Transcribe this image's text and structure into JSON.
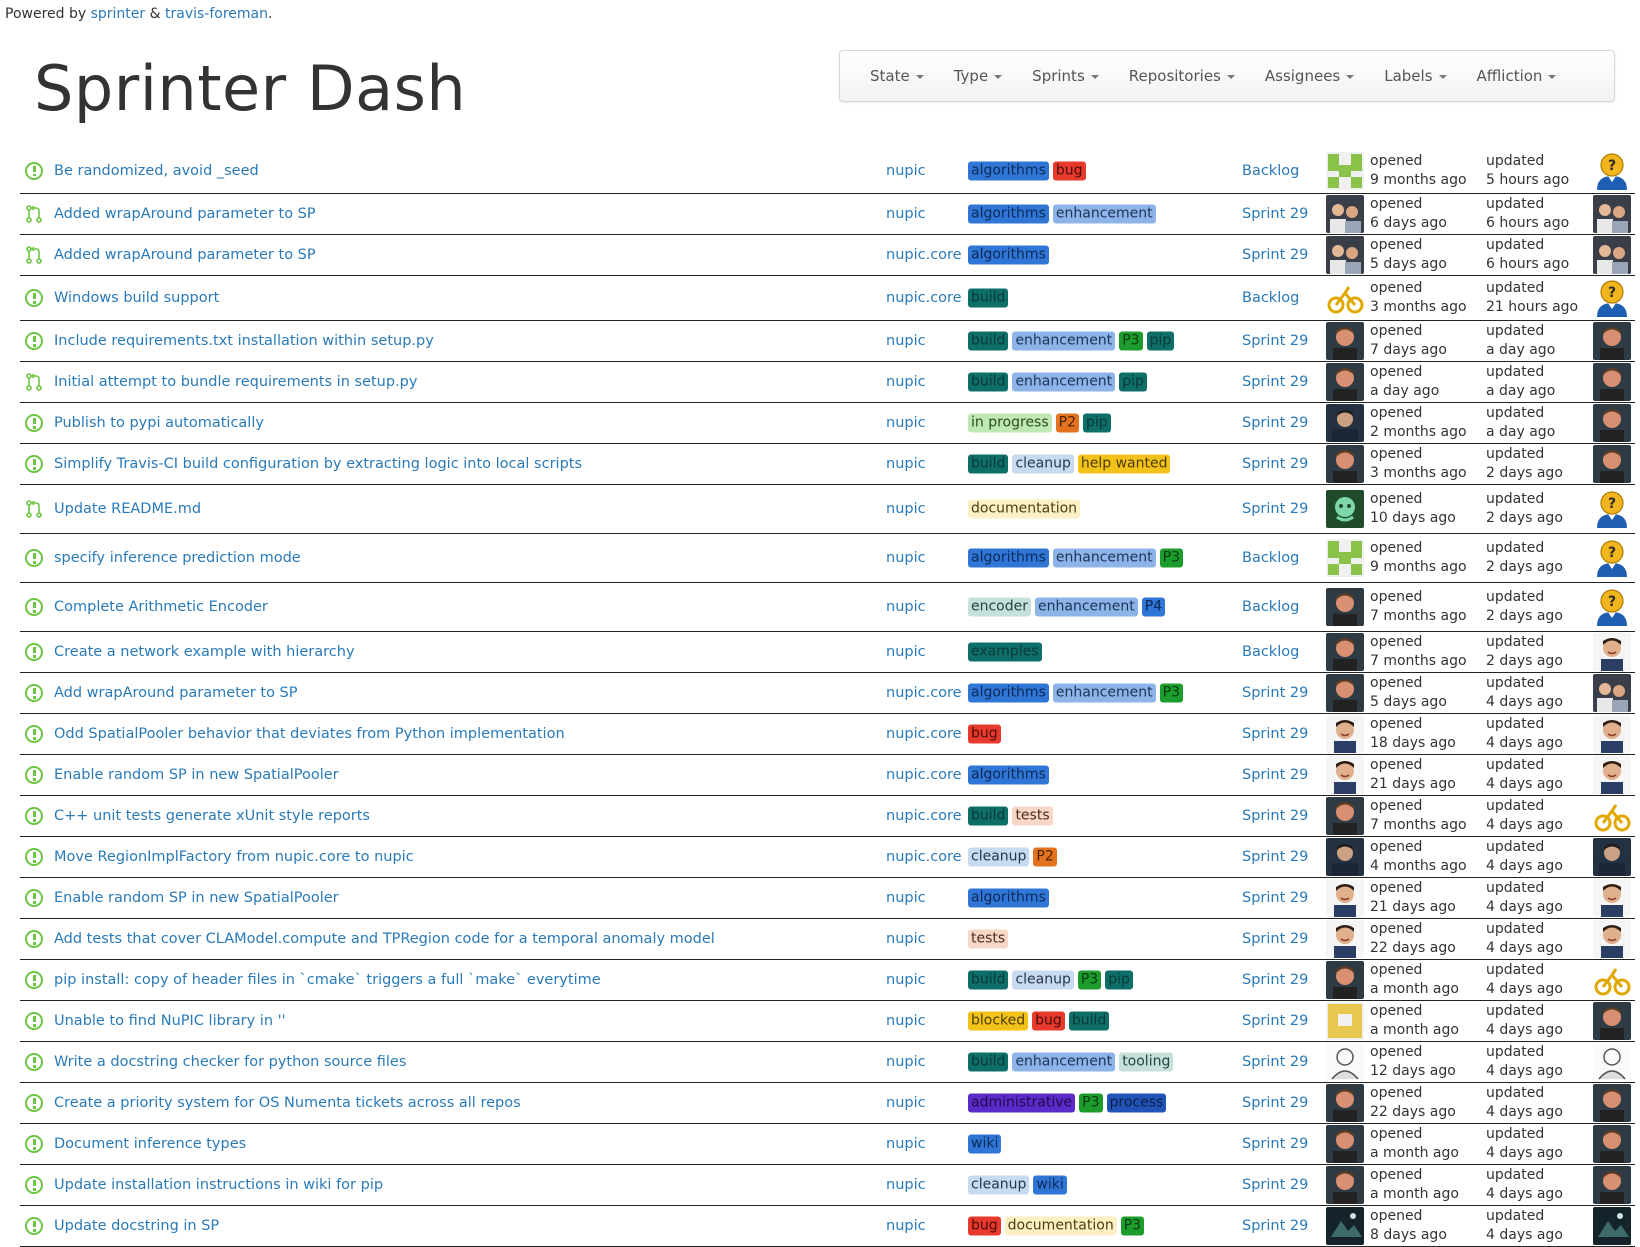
{
  "header": {
    "powered_prefix": "Powered by",
    "powered_link1": "sprinter",
    "powered_amp": "&",
    "powered_link2": "travis-foreman",
    "powered_suffix": ".",
    "title": "Sprinter Dash"
  },
  "nav": {
    "items": [
      "State",
      "Type",
      "Sprints",
      "Repositories",
      "Assignees",
      "Labels",
      "Affliction"
    ]
  },
  "meta_labels": {
    "opened": "opened",
    "updated": "updated"
  },
  "label_colors": {
    "algorithms": {
      "bg": "#2f76d6",
      "fg": "#0d2a57"
    },
    "bug": {
      "bg": "#e8392d",
      "fg": "#4a0b07"
    },
    "enhancement": {
      "bg": "#8cb4e8",
      "fg": "#1b3555"
    },
    "build": {
      "bg": "#0e6e68",
      "fg": "#0b3a37"
    },
    "P3": {
      "bg": "#1c9c2c",
      "fg": "#0a3b10"
    },
    "pip": {
      "bg": "#0e6e68",
      "fg": "#0b3a37"
    },
    "in progress": {
      "bg": "#bfe8b3",
      "fg": "#2c4a26"
    },
    "P2": {
      "bg": "#e3731f",
      "fg": "#4a2207"
    },
    "cleanup": {
      "bg": "#c8daf0",
      "fg": "#27384d"
    },
    "help wanted": {
      "bg": "#f2c218",
      "fg": "#4c3c03"
    },
    "documentation": {
      "bg": "#fdf0c4",
      "fg": "#4a3f12"
    },
    "encoder": {
      "bg": "#c6e1dc",
      "fg": "#23443e"
    },
    "P4": {
      "bg": "#2f76d6",
      "fg": "#0d2a57"
    },
    "examples": {
      "bg": "#0e6e68",
      "fg": "#0b3a37"
    },
    "tests": {
      "bg": "#f8d7c7",
      "fg": "#4b2c1e"
    },
    "blocked": {
      "bg": "#f2c218",
      "fg": "#4c3c03"
    },
    "tooling": {
      "bg": "#c6e1dc",
      "fg": "#23443e"
    },
    "administrative": {
      "bg": "#5b2bc9",
      "fg": "#1e0c4a"
    },
    "process": {
      "bg": "#2254b8",
      "fg": "#0b1f4a"
    },
    "wiki": {
      "bg": "#2f76d6",
      "fg": "#0d2a57"
    }
  },
  "issues": [
    {
      "type": "issue",
      "title": "Be randomized, avoid _seed",
      "repo": "nupic",
      "labels": [
        "algorithms",
        "bug"
      ],
      "sprint": "Backlog",
      "opened": "9 months ago",
      "updated": "5 hours ago",
      "opener_avatar": "identicon-green",
      "assignee_avatar": "unassigned"
    },
    {
      "type": "pr",
      "title": "Added wrapAround parameter to SP",
      "repo": "nupic",
      "labels": [
        "algorithms",
        "enhancement"
      ],
      "sprint": "Sprint 29",
      "opened": "6 days ago",
      "updated": "6 hours ago",
      "opener_avatar": "photo-group",
      "assignee_avatar": "photo-group"
    },
    {
      "type": "pr",
      "title": "Added wrapAround parameter to SP",
      "repo": "nupic.core",
      "labels": [
        "algorithms"
      ],
      "sprint": "Sprint 29",
      "opened": "5 days ago",
      "updated": "6 hours ago",
      "opener_avatar": "photo-group",
      "assignee_avatar": "photo-group"
    },
    {
      "type": "issue",
      "title": "Windows build support",
      "repo": "nupic.core",
      "labels": [
        "build"
      ],
      "sprint": "Backlog",
      "opened": "3 months ago",
      "updated": "21 hours ago",
      "opener_avatar": "bike-yellow",
      "assignee_avatar": "unassigned"
    },
    {
      "type": "issue",
      "title": "Include requirements.txt installation within setup.py",
      "repo": "nupic",
      "labels": [
        "build",
        "enhancement",
        "P3",
        "pip"
      ],
      "sprint": "Sprint 29",
      "opened": "7 days ago",
      "updated": "a day ago",
      "opener_avatar": "photo-man-red",
      "assignee_avatar": "photo-man-red"
    },
    {
      "type": "pr",
      "title": "Initial attempt to bundle requirements in setup.py",
      "repo": "nupic",
      "labels": [
        "build",
        "enhancement",
        "pip"
      ],
      "sprint": "Sprint 29",
      "opened": "a day ago",
      "updated": "a day ago",
      "opener_avatar": "photo-man-red",
      "assignee_avatar": "photo-man-red"
    },
    {
      "type": "issue",
      "title": "Publish to pypi automatically",
      "repo": "nupic",
      "labels": [
        "in progress",
        "P2",
        "pip"
      ],
      "sprint": "Sprint 29",
      "opened": "2 months ago",
      "updated": "a day ago",
      "opener_avatar": "photo-man-dark",
      "assignee_avatar": "photo-man-red"
    },
    {
      "type": "issue",
      "title": "Simplify Travis-CI build configuration by extracting logic into local scripts",
      "repo": "nupic",
      "labels": [
        "build",
        "cleanup",
        "help wanted"
      ],
      "sprint": "Sprint 29",
      "opened": "3 months ago",
      "updated": "2 days ago",
      "opener_avatar": "photo-man-red",
      "assignee_avatar": "photo-man-red"
    },
    {
      "type": "pr",
      "title": "Update README.md",
      "repo": "nupic",
      "labels": [
        "documentation"
      ],
      "sprint": "Sprint 29",
      "opened": "10 days ago",
      "updated": "2 days ago",
      "opener_avatar": "octocat-green",
      "assignee_avatar": "unassigned"
    },
    {
      "type": "issue",
      "title": "specify inference prediction mode",
      "repo": "nupic",
      "labels": [
        "algorithms",
        "enhancement",
        "P3"
      ],
      "sprint": "Backlog",
      "opened": "9 months ago",
      "updated": "2 days ago",
      "opener_avatar": "identicon-green",
      "assignee_avatar": "unassigned"
    },
    {
      "type": "issue",
      "title": "Complete Arithmetic Encoder",
      "repo": "nupic",
      "labels": [
        "encoder",
        "enhancement",
        "P4"
      ],
      "sprint": "Backlog",
      "opened": "7 months ago",
      "updated": "2 days ago",
      "opener_avatar": "photo-man-red",
      "assignee_avatar": "unassigned"
    },
    {
      "type": "issue",
      "title": "Create a network example with hierarchy",
      "repo": "nupic",
      "labels": [
        "examples"
      ],
      "sprint": "Backlog",
      "opened": "7 months ago",
      "updated": "2 days ago",
      "opener_avatar": "photo-man-red",
      "assignee_avatar": "photo-man-smile"
    },
    {
      "type": "issue",
      "title": "Add wrapAround parameter to SP",
      "repo": "nupic.core",
      "labels": [
        "algorithms",
        "enhancement",
        "P3"
      ],
      "sprint": "Sprint 29",
      "opened": "5 days ago",
      "updated": "4 days ago",
      "opener_avatar": "photo-man-red",
      "assignee_avatar": "photo-group"
    },
    {
      "type": "issue",
      "title": "Odd SpatialPooler behavior that deviates from Python implementation",
      "repo": "nupic.core",
      "labels": [
        "bug"
      ],
      "sprint": "Sprint 29",
      "opened": "18 days ago",
      "updated": "4 days ago",
      "opener_avatar": "photo-man-smile",
      "assignee_avatar": "photo-man-smile"
    },
    {
      "type": "issue",
      "title": "Enable random SP in new SpatialPooler",
      "repo": "nupic.core",
      "labels": [
        "algorithms"
      ],
      "sprint": "Sprint 29",
      "opened": "21 days ago",
      "updated": "4 days ago",
      "opener_avatar": "photo-man-smile",
      "assignee_avatar": "photo-man-smile"
    },
    {
      "type": "issue",
      "title": "C++ unit tests generate xUnit style reports",
      "repo": "nupic.core",
      "labels": [
        "build",
        "tests"
      ],
      "sprint": "Sprint 29",
      "opened": "7 months ago",
      "updated": "4 days ago",
      "opener_avatar": "photo-man-red",
      "assignee_avatar": "bike-yellow"
    },
    {
      "type": "issue",
      "title": "Move RegionImplFactory from nupic.core to nupic",
      "repo": "nupic.core",
      "labels": [
        "cleanup",
        "P2"
      ],
      "sprint": "Sprint 29",
      "opened": "4 months ago",
      "updated": "4 days ago",
      "opener_avatar": "photo-man-dark",
      "assignee_avatar": "photo-man-dark"
    },
    {
      "type": "issue",
      "title": "Enable random SP in new SpatialPooler",
      "repo": "nupic",
      "labels": [
        "algorithms"
      ],
      "sprint": "Sprint 29",
      "opened": "21 days ago",
      "updated": "4 days ago",
      "opener_avatar": "photo-man-smile",
      "assignee_avatar": "photo-man-smile"
    },
    {
      "type": "issue",
      "title": "Add tests that cover CLAModel.compute and TPRegion code for a temporal anomaly model",
      "repo": "nupic",
      "labels": [
        "tests"
      ],
      "sprint": "Sprint 29",
      "opened": "22 days ago",
      "updated": "4 days ago",
      "opener_avatar": "photo-man-smile",
      "assignee_avatar": "photo-man-smile"
    },
    {
      "type": "issue",
      "title": "pip install: copy of header files in `cmake` triggers a full `make` everytime",
      "repo": "nupic",
      "labels": [
        "build",
        "cleanup",
        "P3",
        "pip"
      ],
      "sprint": "Sprint 29",
      "opened": "a month ago",
      "updated": "4 days ago",
      "opener_avatar": "photo-man-red",
      "assignee_avatar": "bike-yellow"
    },
    {
      "type": "issue",
      "title": "Unable to find NuPIC library in ''",
      "repo": "nupic",
      "labels": [
        "blocked",
        "bug",
        "build"
      ],
      "sprint": "Sprint 29",
      "opened": "a month ago",
      "updated": "4 days ago",
      "opener_avatar": "identicon-yellow",
      "assignee_avatar": "photo-man-red"
    },
    {
      "type": "issue",
      "title": "Write a docstring checker for python source files",
      "repo": "nupic",
      "labels": [
        "build",
        "enhancement",
        "tooling"
      ],
      "sprint": "Sprint 29",
      "opened": "12 days ago",
      "updated": "4 days ago",
      "opener_avatar": "sketch-gray",
      "assignee_avatar": "sketch-gray"
    },
    {
      "type": "issue",
      "title": "Create a priority system for OS Numenta tickets across all repos",
      "repo": "nupic",
      "labels": [
        "administrative",
        "P3",
        "process"
      ],
      "sprint": "Sprint 29",
      "opened": "22 days ago",
      "updated": "4 days ago",
      "opener_avatar": "photo-man-red",
      "assignee_avatar": "photo-man-red"
    },
    {
      "type": "issue",
      "title": "Document inference types",
      "repo": "nupic",
      "labels": [
        "wiki"
      ],
      "sprint": "Sprint 29",
      "opened": "a month ago",
      "updated": "4 days ago",
      "opener_avatar": "photo-man-red",
      "assignee_avatar": "photo-man-red"
    },
    {
      "type": "issue",
      "title": "Update installation instructions in wiki for pip",
      "repo": "nupic",
      "labels": [
        "cleanup",
        "wiki"
      ],
      "sprint": "Sprint 29",
      "opened": "a month ago",
      "updated": "4 days ago",
      "opener_avatar": "photo-man-red",
      "assignee_avatar": "photo-man-red"
    },
    {
      "type": "issue",
      "title": "Update docstring in SP",
      "repo": "nupic",
      "labels": [
        "bug",
        "documentation",
        "P3"
      ],
      "sprint": "Sprint 29",
      "opened": "8 days ago",
      "updated": "4 days ago",
      "opener_avatar": "photo-night",
      "assignee_avatar": "photo-night"
    }
  ]
}
